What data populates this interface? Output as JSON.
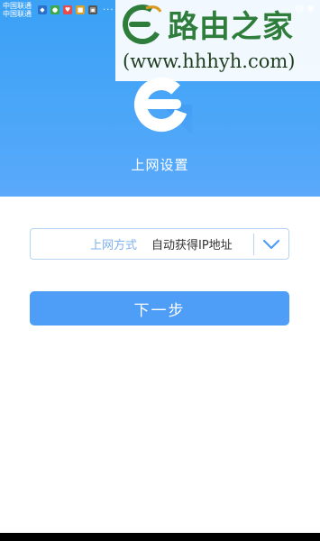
{
  "status_bar": {
    "carrier_line1": "中国联通",
    "carrier_line2": "中国联通",
    "more_dots": "···",
    "right_text": "@ ◉"
  },
  "watermark": {
    "text": "路由之家",
    "url": "(www.hhhyh.com)"
  },
  "app": {
    "logo_icon": "e-logo-icon",
    "title": "上网设置"
  },
  "form": {
    "method_label": "上网方式",
    "method_value": "自动获得IP地址",
    "dropdown_icon": "chevron-down-icon"
  },
  "next_button": "下一步",
  "colors": {
    "header_blue": "#44a5f7",
    "button_blue": "#4e9df6",
    "border_blue": "#b7d4f2",
    "watermark_green": "#2e7d3a"
  }
}
